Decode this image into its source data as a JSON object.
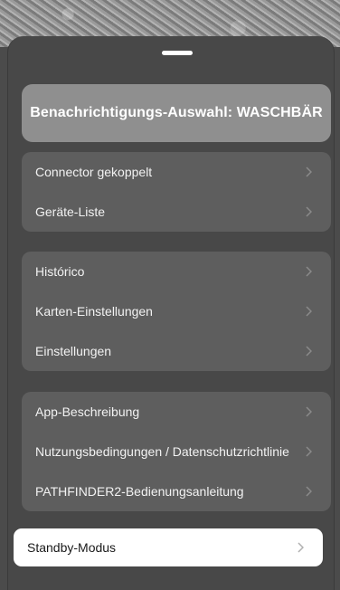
{
  "banner": {
    "label": "Benachrichtigungs-Auswahl: WASCHBÄR"
  },
  "groups": [
    {
      "items": [
        {
          "label": "Connector gekoppelt"
        },
        {
          "label": "Geräte-Liste"
        }
      ]
    },
    {
      "items": [
        {
          "label": "Histórico"
        },
        {
          "label": "Karten-Einstellungen"
        },
        {
          "label": "Einstellungen"
        }
      ]
    },
    {
      "items": [
        {
          "label": "App-Beschreibung"
        },
        {
          "label": "Nutzungsbedingungen / Datenschutzrichtlinie"
        },
        {
          "label": "PATHFINDER2-Bedienungsanleitung"
        }
      ]
    }
  ],
  "standby": {
    "label": "Standby-Modus"
  },
  "icons": {
    "row_chevron": "chevron-right-icon",
    "grabber": "drag-handle"
  },
  "colors": {
    "sheet_bg": "#484848",
    "group_bg": "#5e5e5e",
    "banner_bg": "#8f8f8f",
    "standby_bg": "#ffffff"
  }
}
